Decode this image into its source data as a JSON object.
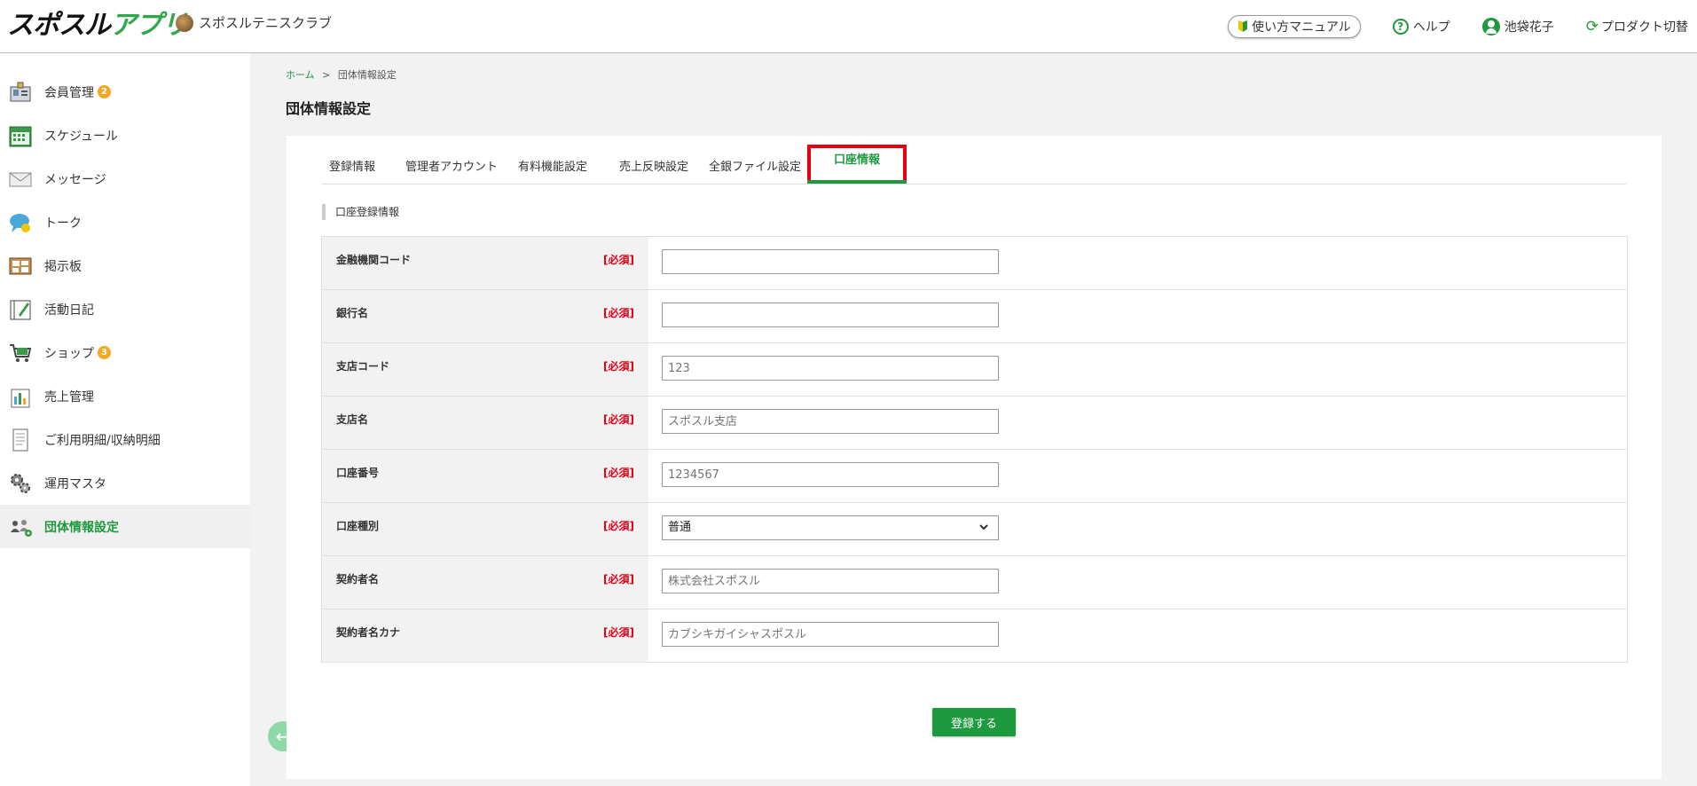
{
  "header": {
    "logo_part1": "スポスル",
    "logo_part2": "アプリ",
    "club_name": "スポスルテニスクラブ",
    "manual": "使い方マニュアル",
    "help": "ヘルプ",
    "user": "池袋花子",
    "product_switch": "プロダクト切替"
  },
  "sidebar": {
    "items": [
      {
        "label": "会員管理",
        "badge": "2",
        "icon": "members-icon"
      },
      {
        "label": "スケジュール",
        "badge": "",
        "icon": "calendar-icon"
      },
      {
        "label": "メッセージ",
        "badge": "",
        "icon": "envelope-icon"
      },
      {
        "label": "トーク",
        "badge": "",
        "icon": "chat-icon"
      },
      {
        "label": "掲示板",
        "badge": "",
        "icon": "bulletin-board-icon"
      },
      {
        "label": "活動日記",
        "badge": "",
        "icon": "diary-icon"
      },
      {
        "label": "ショップ",
        "badge": "3",
        "icon": "cart-icon"
      },
      {
        "label": "売上管理",
        "badge": "",
        "icon": "sales-icon"
      },
      {
        "label": "ご利用明細/収納明細",
        "badge": "",
        "icon": "document-icon"
      },
      {
        "label": "運用マスタ",
        "badge": "",
        "icon": "gears-icon"
      },
      {
        "label": "団体情報設定",
        "badge": "",
        "icon": "group-settings-icon"
      }
    ]
  },
  "breadcrumb": {
    "home": "ホーム",
    "sep": ">",
    "current": "団体情報設定"
  },
  "page_title": "団体情報設定",
  "tabs": [
    "登録情報",
    "管理者アカウント",
    "有料機能設定",
    "売上反映設定",
    "全銀ファイル設定",
    "口座情報"
  ],
  "section_title": "口座登録情報",
  "required_label": "[必須]",
  "form": {
    "rows": [
      {
        "label": "金融機関コード",
        "value": "",
        "placeholder": ""
      },
      {
        "label": "銀行名",
        "value": "",
        "placeholder": ""
      },
      {
        "label": "支店コード",
        "value": "",
        "placeholder": "123"
      },
      {
        "label": "支店名",
        "value": "",
        "placeholder": "スポスル支店"
      },
      {
        "label": "口座番号",
        "value": "",
        "placeholder": "1234567"
      },
      {
        "label": "口座種別",
        "value": "普通",
        "placeholder": ""
      },
      {
        "label": "契約者名",
        "value": "",
        "placeholder": "株式会社スポスル"
      },
      {
        "label": "契約者名カナ",
        "value": "",
        "placeholder": "カブシキガイシャスポスル"
      }
    ]
  },
  "submit_label": "登録する",
  "colors": {
    "brand_green": "#1e9a3e",
    "highlight_red": "#e60012",
    "badge_orange": "#f5a623"
  }
}
